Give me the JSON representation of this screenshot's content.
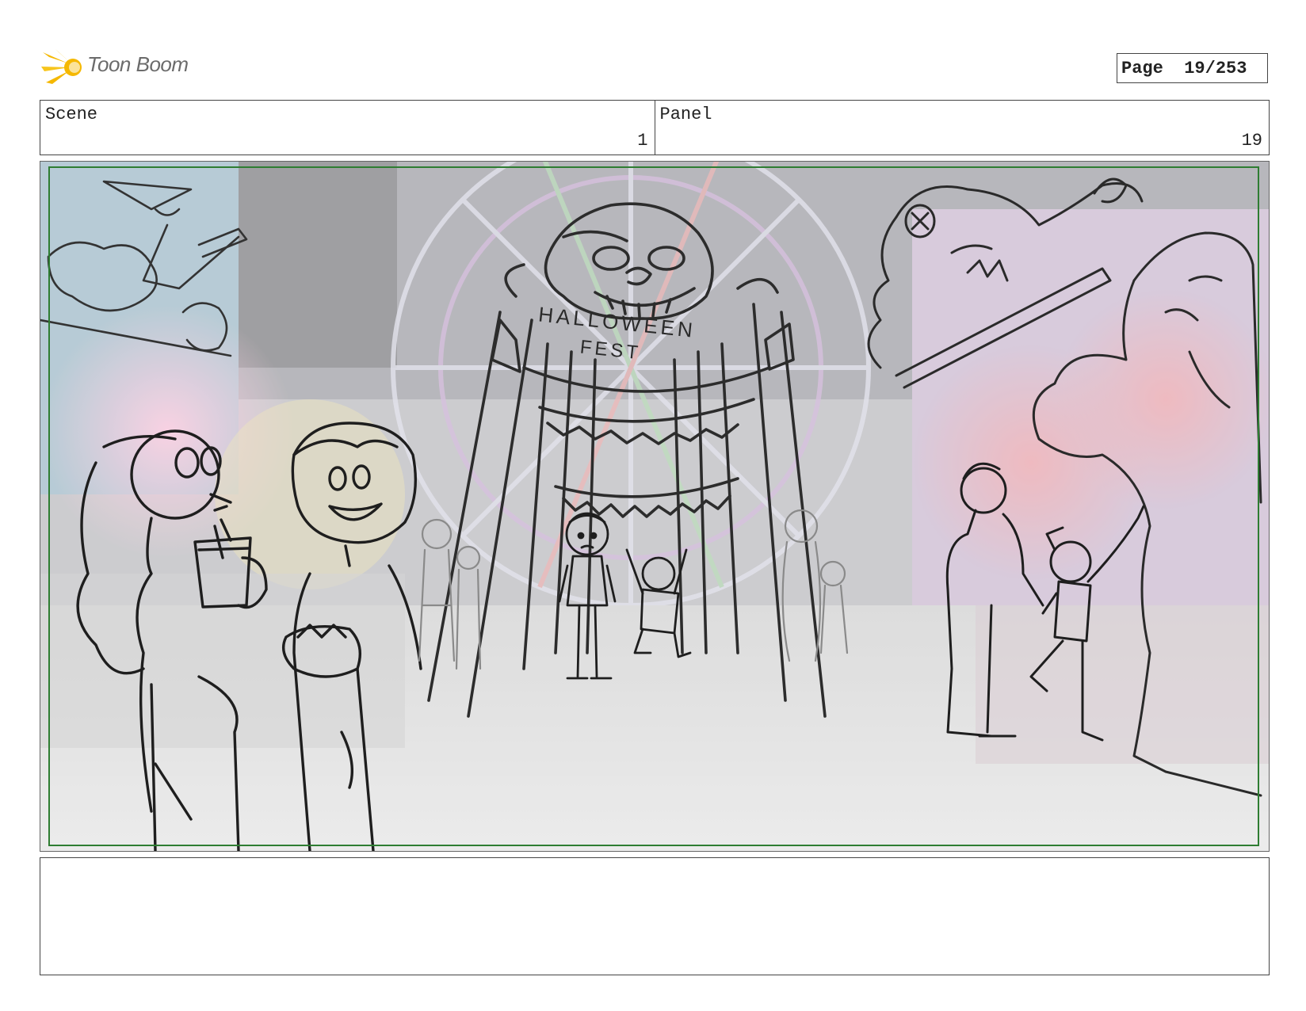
{
  "header": {
    "logo_text": "Toon Boom",
    "page_label": "Page",
    "page_number": "19/253"
  },
  "scene": {
    "label": "Scene",
    "value": "1"
  },
  "panel": {
    "label": "Panel",
    "value": "19"
  },
  "drawing": {
    "banner_line1": "HALLOWEEN",
    "banner_line2": "FEST"
  },
  "notes": {
    "text": ""
  },
  "colors": {
    "safe_frame": "#2e7d32",
    "logo_flare": "#f5b800",
    "sketch_line": "#1e1e1e"
  }
}
